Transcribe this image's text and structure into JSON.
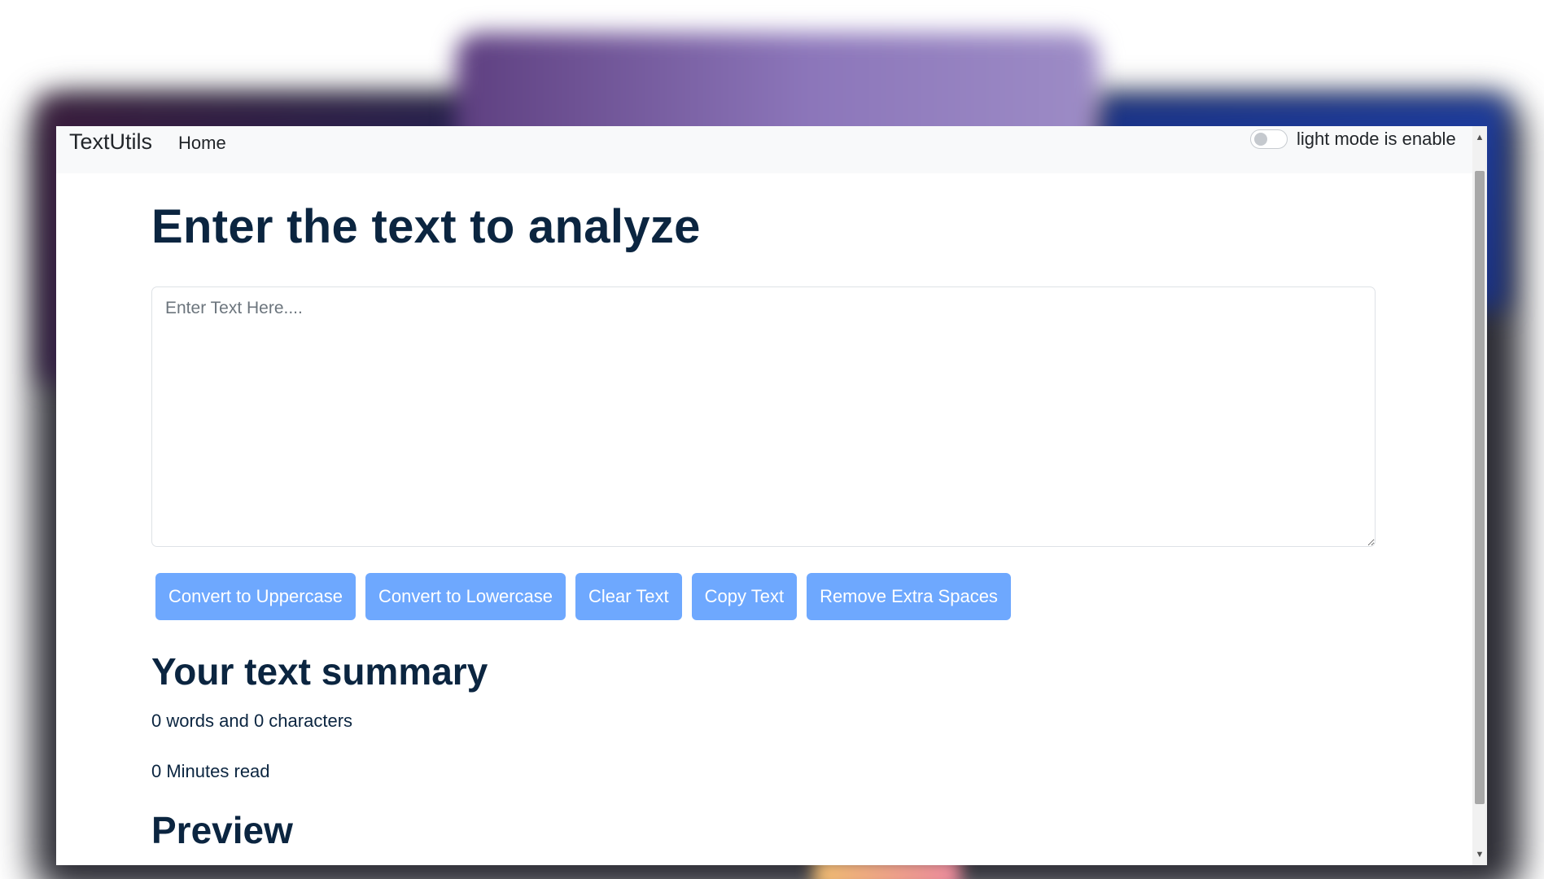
{
  "navbar": {
    "brand": "TextUtils",
    "home_link": "Home",
    "mode_label": "light mode is enable",
    "mode_enabled": false
  },
  "main": {
    "heading": "Enter the text to analyze",
    "textarea": {
      "placeholder": "Enter Text Here....",
      "value": ""
    },
    "buttons": [
      "Convert to Uppercase",
      "Convert to Lowercase",
      "Clear Text",
      "Copy Text",
      "Remove Extra Spaces"
    ]
  },
  "summary": {
    "heading": "Your text summary",
    "words_chars": "0 words and 0 characters",
    "read_time": "0 Minutes read"
  },
  "preview": {
    "heading": "Preview"
  },
  "colors": {
    "button_bg": "#6ea8fe",
    "heading_color": "#0b2540",
    "navbar_bg": "#f8f9fa"
  }
}
